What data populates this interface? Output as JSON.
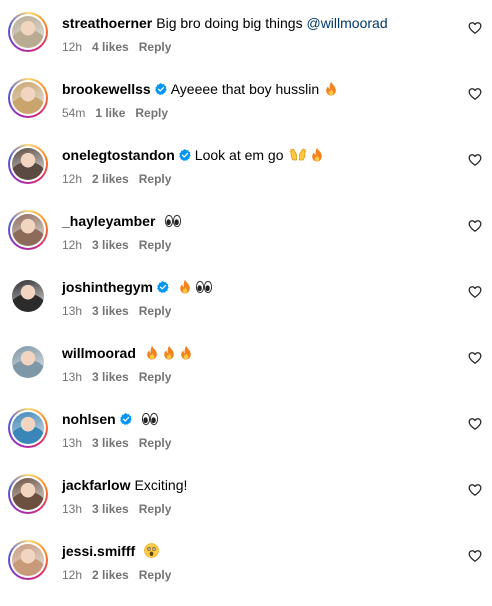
{
  "comments": [
    {
      "username": "streathoerner",
      "verified": false,
      "text": "Big bro doing big things ",
      "mention": "@willmoorad",
      "emojis": [],
      "time": "12h",
      "likes": "4 likes",
      "reply": "Reply",
      "ring": true,
      "avatar_color": "#b9ab92"
    },
    {
      "username": "brookewellss",
      "verified": true,
      "text": "Ayeeee that boy husslin",
      "mention": "",
      "emojis": [
        "fire"
      ],
      "time": "54m",
      "likes": "1 like",
      "reply": "Reply",
      "ring": true,
      "avatar_color": "#c9a46d"
    },
    {
      "username": "onelegtostandon",
      "verified": true,
      "text": "Look at em go",
      "mention": "",
      "emojis": [
        "raised-hands",
        "fire"
      ],
      "time": "12h",
      "likes": "2 likes",
      "reply": "Reply",
      "ring": true,
      "avatar_color": "#5a4a42"
    },
    {
      "username": "_hayleyamber",
      "verified": false,
      "text": "",
      "mention": "",
      "emojis": [
        "eyes"
      ],
      "time": "12h",
      "likes": "3 likes",
      "reply": "Reply",
      "ring": true,
      "avatar_color": "#8d6b5b"
    },
    {
      "username": "joshinthegym",
      "verified": true,
      "text": "",
      "mention": "",
      "emojis": [
        "fire",
        "eyes"
      ],
      "time": "13h",
      "likes": "3 likes",
      "reply": "Reply",
      "ring": false,
      "avatar_color": "#2b2b2b"
    },
    {
      "username": "willmoorad",
      "verified": false,
      "text": "",
      "mention": "",
      "emojis": [
        "fire",
        "fire",
        "fire"
      ],
      "time": "13h",
      "likes": "3 likes",
      "reply": "Reply",
      "ring": false,
      "avatar_color": "#7f98a8"
    },
    {
      "username": "nohlsen",
      "verified": true,
      "text": "",
      "mention": "",
      "emojis": [
        "eyes"
      ],
      "time": "13h",
      "likes": "3 likes",
      "reply": "Reply",
      "ring": true,
      "avatar_color": "#3a86b8"
    },
    {
      "username": "jackfarlow",
      "verified": false,
      "text": "Exciting!",
      "mention": "",
      "emojis": [],
      "time": "13h",
      "likes": "3 likes",
      "reply": "Reply",
      "ring": true,
      "avatar_color": "#6b4f3f"
    },
    {
      "username": "jessi.smifff",
      "verified": false,
      "text": "",
      "mention": "",
      "emojis": [
        "astonished-face"
      ],
      "time": "12h",
      "likes": "2 likes",
      "reply": "Reply",
      "ring": true,
      "avatar_color": "#c99a7a"
    }
  ],
  "colors": {
    "verified": "#0095f6",
    "meta": "#737373",
    "mention": "#00376b"
  }
}
